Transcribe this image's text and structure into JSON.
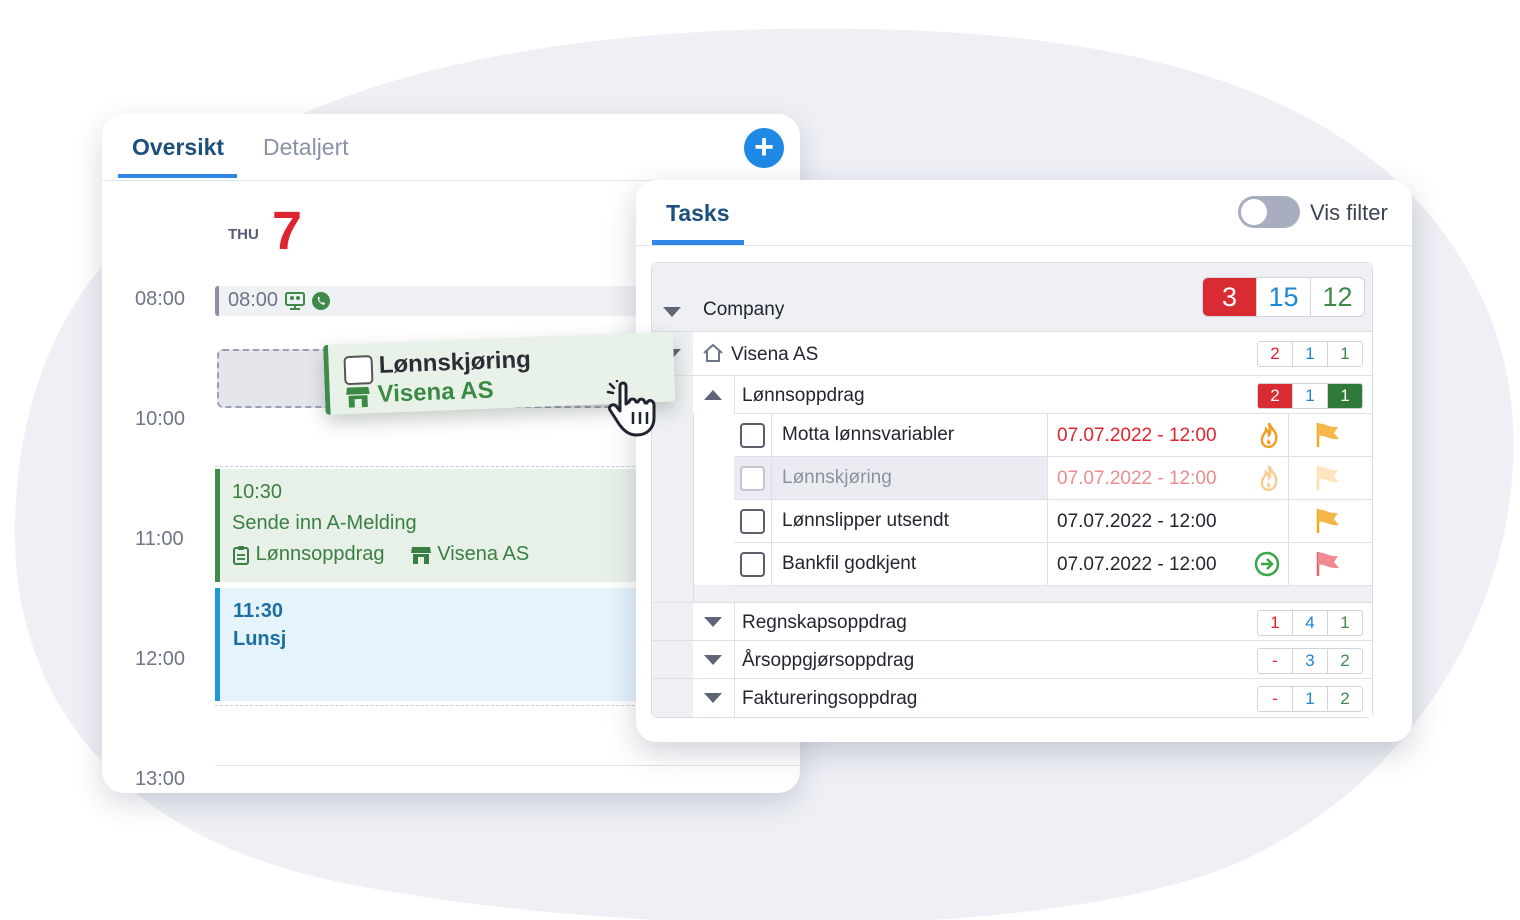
{
  "calendar": {
    "tabs": [
      {
        "label": "Oversikt",
        "active": true
      },
      {
        "label": "Detaljert",
        "active": false
      }
    ],
    "add_button": "+",
    "day_name": "THU",
    "day_number": "7",
    "times": [
      "08:00",
      "10:00",
      "11:00",
      "12:00",
      "13:00"
    ],
    "events": {
      "e1": {
        "time": "08:00"
      },
      "e2": {
        "time": "10:30",
        "title": "Sende inn A-Melding",
        "project": "Lønnsoppdrag",
        "company": "Visena AS"
      },
      "e3": {
        "time": "11:30",
        "title": "Lunsj"
      }
    },
    "drag": {
      "title": "Lønnskjøring",
      "company": "Visena AS"
    }
  },
  "tasks": {
    "title": "Tasks",
    "filter_label": "Vis filter",
    "header": {
      "label": "Company",
      "counts": [
        "3",
        "15",
        "12"
      ]
    },
    "company": {
      "label": "Visena AS",
      "counts": [
        "2",
        "1",
        "1"
      ]
    },
    "groups": [
      {
        "label": "Lønnsoppdrag",
        "counts": [
          "2",
          "1",
          "1"
        ],
        "expanded": true
      },
      {
        "label": "Regnskapsoppdrag",
        "counts": [
          "1",
          "4",
          "1"
        ],
        "expanded": false
      },
      {
        "label": "Årsoppgjørsoppdrag",
        "counts": [
          "-",
          "3",
          "2"
        ],
        "expanded": false
      },
      {
        "label": "Faktureringsoppdrag",
        "counts": [
          "-",
          "1",
          "2"
        ],
        "expanded": false
      }
    ],
    "items": [
      {
        "name": "Motta lønnsvariabler",
        "date": "07.07.2022 - 12:00",
        "icon": "fire-icon",
        "flag": "orange-flag"
      },
      {
        "name": "Lønnskjøring",
        "date": "07.07.2022 - 12:00",
        "icon": "fire-icon",
        "flag": "orange-flag"
      },
      {
        "name": "Lønnslipper utsendt",
        "date": "07.07.2022 - 12:00",
        "icon": "",
        "flag": "orange-flag"
      },
      {
        "name": "Bankfil godkjent",
        "date": "07.07.2022 - 12:00",
        "icon": "arrow-circle-icon",
        "flag": "red-flag"
      }
    ]
  },
  "colors": {
    "accent": "#2f86e5",
    "red": "#e0232d",
    "green": "#3f8a4a",
    "blue": "#1f86d6"
  }
}
